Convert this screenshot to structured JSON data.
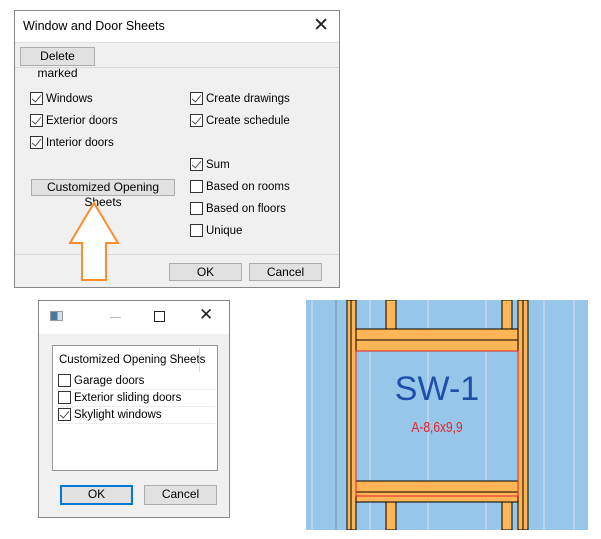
{
  "main_dialog": {
    "title": "Window and Door Sheets",
    "delete_marked": "Delete marked",
    "left_options": [
      {
        "label": "Windows",
        "checked": true
      },
      {
        "label": "Exterior doors",
        "checked": true
      },
      {
        "label": "Interior doors",
        "checked": true
      }
    ],
    "right_options": [
      {
        "label": "Create drawings",
        "checked": true
      },
      {
        "label": "Create schedule",
        "checked": true
      },
      {
        "label": "Sum",
        "checked": true
      },
      {
        "label": "Based on rooms",
        "checked": false
      },
      {
        "label": "Based on floors",
        "checked": false
      },
      {
        "label": "Unique",
        "checked": false
      }
    ],
    "customized_button": "Customized Opening Sheets",
    "ok": "OK",
    "cancel": "Cancel",
    "arrow_color": "#ff8c2a"
  },
  "sub_dialog": {
    "group_title": "Customized Opening Sheets",
    "options": [
      {
        "label": "Garage doors",
        "checked": false
      },
      {
        "label": "Exterior sliding doors",
        "checked": false
      },
      {
        "label": "Skylight windows",
        "checked": true
      }
    ],
    "ok": "OK",
    "cancel": "Cancel"
  },
  "drawing": {
    "mark": "SW-1",
    "size": "A-8,6x9,9",
    "mark_color": "#1f4fa8",
    "size_color": "#e8202a",
    "wall_color": "#97c7e8",
    "framing_color": "#ffb455"
  }
}
